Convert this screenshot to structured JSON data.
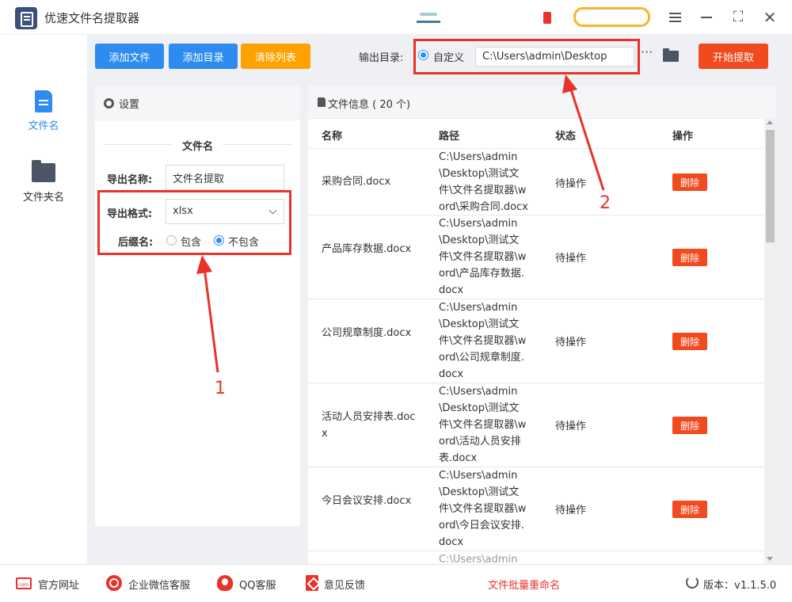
{
  "app": {
    "title": "优速文件名提取器"
  },
  "sidebar": {
    "items": [
      {
        "label": "文件名",
        "icon": "file-icon",
        "active": true
      },
      {
        "label": "文件夹名",
        "icon": "folder-icon",
        "active": false
      }
    ]
  },
  "toolbar": {
    "add_file": "添加文件",
    "add_dir": "添加目录",
    "clear_list": "清除列表",
    "output_label": "输出目录:",
    "output_option": "自定义",
    "output_path": "C:\\Users\\admin\\Desktop",
    "more": "···",
    "start": "开始提取"
  },
  "settings": {
    "header": "设置",
    "section_title": "文件名",
    "export_name_label": "导出名称:",
    "export_name_value": "文件名提取",
    "export_format_label": "导出格式:",
    "export_format_value": "xlsx",
    "suffix_label": "后缀名:",
    "suffix_include": "包含",
    "suffix_exclude": "不包含",
    "suffix_selected": "不包含"
  },
  "file_info": {
    "header": "文件信息 ( 20 个)",
    "columns": [
      "名称",
      "路径",
      "状态",
      "操作"
    ],
    "rows": [
      {
        "name": "采购合同.docx",
        "path": "C:\\Users\\admin\\Desktop\\测试文件\\文件名提取器\\word\\采购合同.docx",
        "status": "待操作",
        "action": "删除"
      },
      {
        "name": "产品库存数据.docx",
        "path": "C:\\Users\\admin\\Desktop\\测试文件\\文件名提取器\\word\\产品库存数据.docx",
        "status": "待操作",
        "action": "删除"
      },
      {
        "name": "公司规章制度.docx",
        "path": "C:\\Users\\admin\\Desktop\\测试文件\\文件名提取器\\word\\公司规章制度.docx",
        "status": "待操作",
        "action": "删除"
      },
      {
        "name": "活动人员安排表.docx",
        "path": "C:\\Users\\admin\\Desktop\\测试文件\\文件名提取器\\word\\活动人员安排表.docx",
        "status": "待操作",
        "action": "删除"
      },
      {
        "name": "今日会议安排.docx",
        "path": "C:\\Users\\admin\\Desktop\\测试文件\\文件名提取器\\word\\今日会议安排.docx",
        "status": "待操作",
        "action": "删除"
      },
      {
        "name": "",
        "path": "C:\\Users\\admin\\D",
        "status": "",
        "action": ""
      }
    ]
  },
  "annotations": {
    "label_1": "1",
    "label_2": "2",
    "color": "#e8322a"
  },
  "footer": {
    "website": "官方网址",
    "wechat": "企业微信客服",
    "qq": "QQ客服",
    "feedback": "意见反馈",
    "rename": "文件批量重命名",
    "version": "版本：v1.1.5.0"
  },
  "colors": {
    "primary": "#2e8cf0",
    "orange": "#ffa200",
    "danger": "#f04a1e"
  }
}
